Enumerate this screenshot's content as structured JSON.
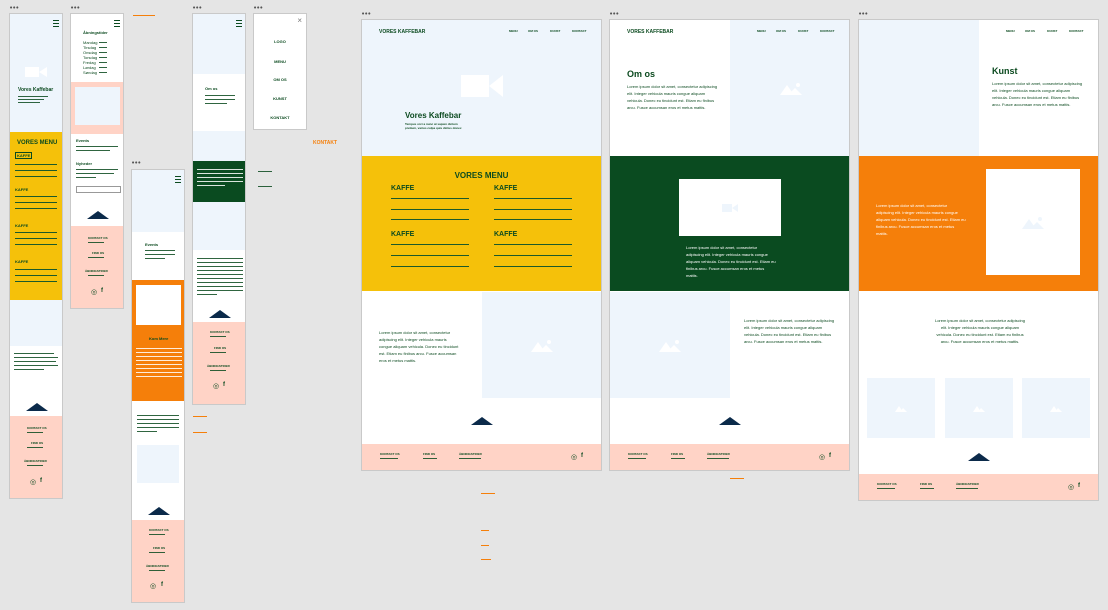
{
  "mobile": {
    "hero_title": "Vores Kaffebar",
    "menu_title": "VORES MENU",
    "menu_item": "KAFFE",
    "contact": "KONTAKT OS",
    "hours": "ÅBNINGSTIDER",
    "address": "FIND OS"
  },
  "hours_frame": {
    "title": "Åbningstider",
    "days": [
      "Mandag",
      "Tirsdag",
      "Onsdag",
      "Torsdag",
      "Fredag",
      "Lørdag",
      "Søndag"
    ],
    "section1": "Events",
    "section2": "Nyheder"
  },
  "nav_menu": {
    "items": [
      "LOGO",
      "MENU",
      "OM OS",
      "KUNST",
      "KONTAKT"
    ]
  },
  "orange_label": "KONTAKT",
  "about_frame": {
    "title": "Om os"
  },
  "events_frame": {
    "title": "Events",
    "banner": "Kom Mere"
  },
  "desktop_home": {
    "brand": "VORES KAFFEBAR",
    "nav": [
      "MENU",
      "OM OS",
      "KUNST",
      "KONTAKT"
    ],
    "hero_title": "Vores Kaffebar",
    "hero_sub": "Tempus orci a nunc at sapien dictum pretium, varius culpa quis dictus donec",
    "menu_title": "VORES MENU",
    "menu_cols": [
      "KAFFE",
      "KAFFE",
      "KAFFE",
      "KAFFE"
    ],
    "lorem": "Lorem ipsum dolor sit amet, consectetur adipiscing elit. Integer vehicula mauris congue aliquam vehicula. Donec eu tincidunt est. Etiam eu finibus arcu. Fusce accumsan eros et metus mattis.",
    "footer": [
      "KONTAKT OS",
      "FIND OS",
      "ÅBNINGSTIDER"
    ]
  },
  "desktop_about": {
    "brand": "VORES KAFFEBAR",
    "nav": [
      "MENU",
      "OM OS",
      "KUNST",
      "KONTAKT"
    ],
    "title": "Om os",
    "footer": [
      "KONTAKT OS",
      "FIND OS",
      "ÅBNINGSTIDER"
    ]
  },
  "desktop_art": {
    "nav": [
      "MENU",
      "OM OS",
      "KUNST",
      "KONTAKT"
    ],
    "title": "Kunst",
    "footer": [
      "KONTAKT OS",
      "FIND OS",
      "ÅBNINGSTIDER"
    ]
  },
  "colors": {
    "green": "#0a4b20",
    "yellow": "#f5c10a",
    "orange": "#f57f0a",
    "pink": "#ffd3c6",
    "pale": "#eef5fc"
  }
}
